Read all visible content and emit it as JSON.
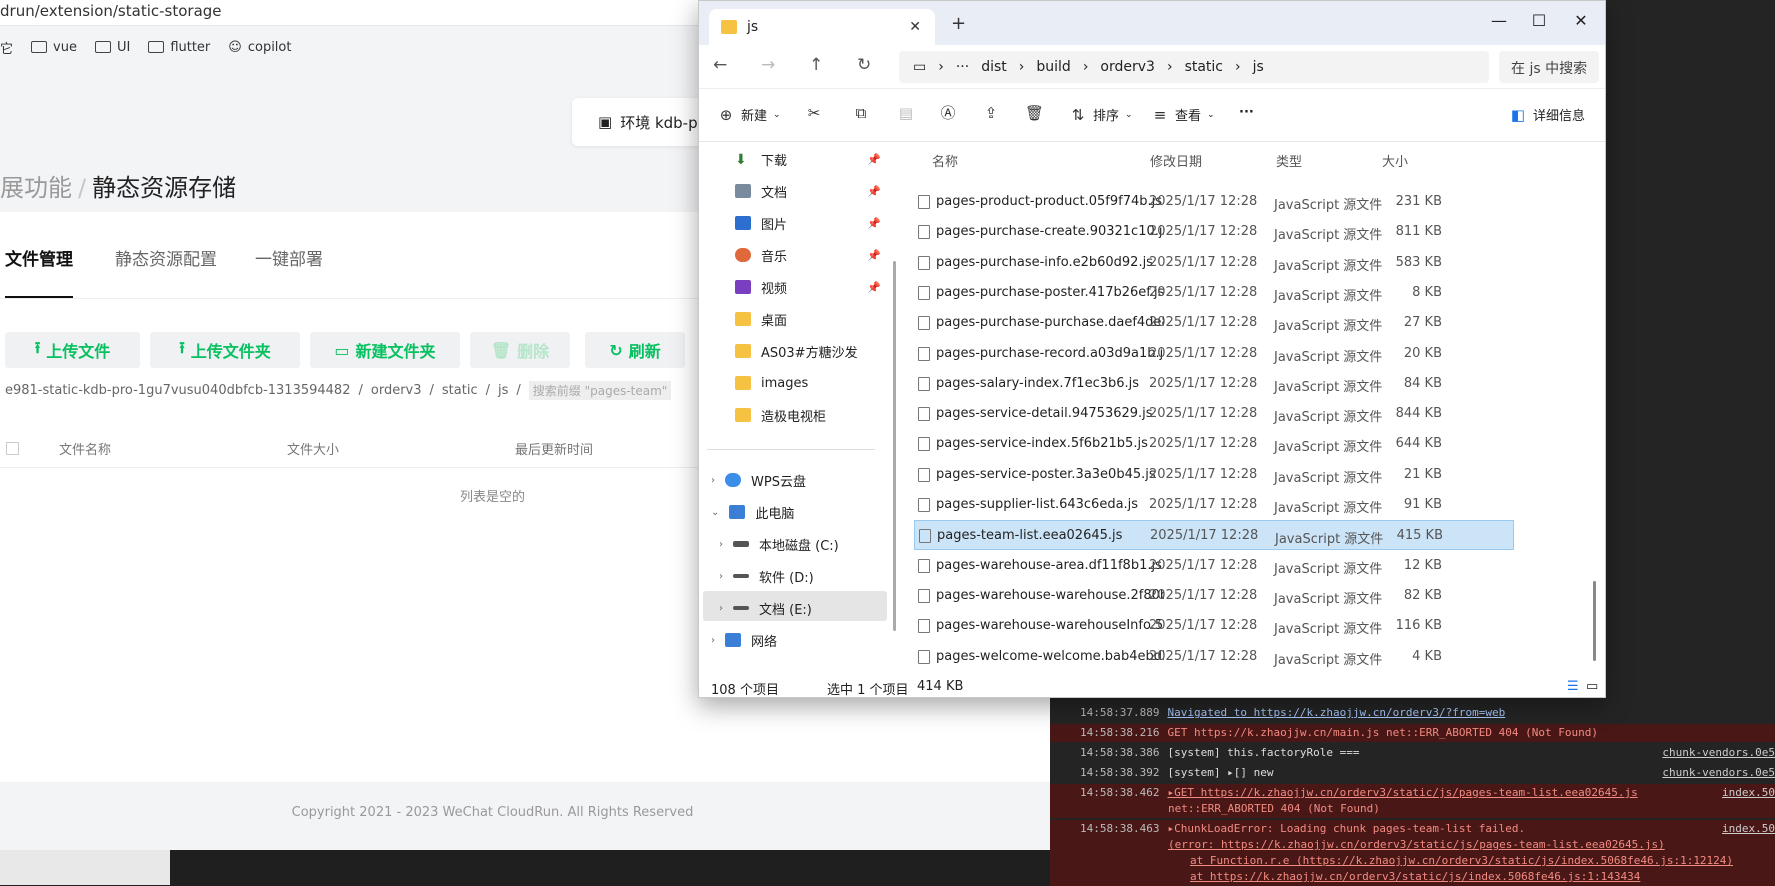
{
  "browser": {
    "url": "drun/extension/static-storage",
    "bookmarks": [
      {
        "label": "它"
      },
      {
        "label": "vue"
      },
      {
        "label": "UI"
      },
      {
        "label": "flutter"
      },
      {
        "label": "copilot"
      }
    ],
    "env_label": "环境 kdb-pro",
    "breadcrumb_parent": "展功能",
    "breadcrumb_sep": "/",
    "page_title": "静态资源存储",
    "tabs": [
      "文件管理",
      "静态资源配置",
      "一键部署"
    ],
    "buttons": [
      "上传文件",
      "上传文件夹",
      "新建文件夹",
      "删除",
      "刷新"
    ],
    "path": [
      "e981-static-kdb-pro-1gu7vusu040dbfcb-1313594482",
      "/",
      "orderv3",
      "/",
      "static",
      "/",
      "js",
      "/"
    ],
    "search_placeholder": "搜索前缀 \"pages-team\"",
    "columns": [
      "文件名称",
      "文件大小",
      "最后更新时间"
    ],
    "empty_text": "列表是空的",
    "copyright": "Copyright 2021 - 2023 WeChat CloudRun. All Rights Reserved"
  },
  "explorer": {
    "tab_title": "js",
    "address": [
      "···",
      "dist",
      "build",
      "orderv3",
      "static",
      "js"
    ],
    "search_placeholder": "在 js 中搜索",
    "commands": {
      "new": "新建",
      "sort": "排序",
      "view": "查看",
      "more": "···",
      "details": "详细信息"
    },
    "nav_items": [
      {
        "label": "下载",
        "pinned": true
      },
      {
        "label": "文档",
        "pinned": true
      },
      {
        "label": "图片",
        "pinned": true
      },
      {
        "label": "音乐",
        "pinned": true
      },
      {
        "label": "视频",
        "pinned": true
      },
      {
        "label": "桌面"
      },
      {
        "label": "AS03#方糖沙发"
      },
      {
        "label": "images"
      },
      {
        "label": "造极电视柜"
      },
      {
        "label": "WPS云盘"
      },
      {
        "label": "此电脑"
      },
      {
        "label": "本地磁盘 (C:)"
      },
      {
        "label": "软件 (D:)"
      },
      {
        "label": "文档 (E:)"
      },
      {
        "label": "网络"
      }
    ],
    "columns": [
      "名称",
      "修改日期",
      "类型",
      "大小"
    ],
    "files": [
      {
        "name": "pages-product-product.05f9f74b.js",
        "date": "2025/1/17 12:28",
        "type": "JavaScript 源文件",
        "size": "231 KB"
      },
      {
        "name": "pages-purchase-create.90321c10.js",
        "date": "2025/1/17 12:28",
        "type": "JavaScript 源文件",
        "size": "811 KB"
      },
      {
        "name": "pages-purchase-info.e2b60d92.js",
        "date": "2025/1/17 12:28",
        "type": "JavaScript 源文件",
        "size": "583 KB"
      },
      {
        "name": "pages-purchase-poster.417b26ef.js",
        "date": "2025/1/17 12:28",
        "type": "JavaScript 源文件",
        "size": "8 KB"
      },
      {
        "name": "pages-purchase-purchase.daef4de8.js",
        "date": "2025/1/17 12:28",
        "type": "JavaScript 源文件",
        "size": "27 KB"
      },
      {
        "name": "pages-purchase-record.a03d9a1b.js",
        "date": "2025/1/17 12:28",
        "type": "JavaScript 源文件",
        "size": "20 KB"
      },
      {
        "name": "pages-salary-index.7f1ec3b6.js",
        "date": "2025/1/17 12:28",
        "type": "JavaScript 源文件",
        "size": "84 KB"
      },
      {
        "name": "pages-service-detail.94753629.js",
        "date": "2025/1/17 12:28",
        "type": "JavaScript 源文件",
        "size": "844 KB"
      },
      {
        "name": "pages-service-index.5f6b21b5.js",
        "date": "2025/1/17 12:28",
        "type": "JavaScript 源文件",
        "size": "644 KB"
      },
      {
        "name": "pages-service-poster.3a3e0b45.js",
        "date": "2025/1/17 12:28",
        "type": "JavaScript 源文件",
        "size": "21 KB"
      },
      {
        "name": "pages-supplier-list.643c6eda.js",
        "date": "2025/1/17 12:28",
        "type": "JavaScript 源文件",
        "size": "91 KB"
      },
      {
        "name": "pages-team-list.eea02645.js",
        "date": "2025/1/17 12:28",
        "type": "JavaScript 源文件",
        "size": "415 KB",
        "selected": true
      },
      {
        "name": "pages-warehouse-area.df11f8b1.js",
        "date": "2025/1/17 12:28",
        "type": "JavaScript 源文件",
        "size": "12 KB"
      },
      {
        "name": "pages-warehouse-warehouse.2f80b2...",
        "date": "2025/1/17 12:28",
        "type": "JavaScript 源文件",
        "size": "82 KB"
      },
      {
        "name": "pages-warehouse-warehouseInfo.53...",
        "date": "2025/1/17 12:28",
        "type": "JavaScript 源文件",
        "size": "116 KB"
      },
      {
        "name": "pages-welcome-welcome.bab4ebd5.js",
        "date": "2025/1/17 12:28",
        "type": "JavaScript 源文件",
        "size": "4 KB"
      }
    ],
    "status_count": "108 个项目",
    "status_selected": "选中 1 个项目",
    "status_size": "414 KB"
  },
  "devtools": {
    "lines": [
      {
        "text": "Navigated to https://k.zhaojjw.cn/orderv3/?from=web",
        "time": "14:58:37.889",
        "source": ""
      },
      {
        "text": "GET https://k.zhaojjw.cn/main.js net::ERR_ABORTED 404 (Not Found)",
        "time": "14:58:38.216",
        "source": "",
        "error": true
      },
      {
        "text": "[system]  this.factoryRole ===",
        "time": "14:58:38.386",
        "source": "chunk-vendors.0e5"
      },
      {
        "text": "[system] ▸[] new",
        "time": "14:58:38.392",
        "source": "chunk-vendors.0e5"
      },
      {
        "text": "▸GET https://k.zhaojjw.cn/orderv3/static/js/pages-team-list.eea02645.js",
        "time": "14:58:38.462",
        "source": "index.50",
        "error": true
      },
      {
        "text": "net::ERR_ABORTED 404 (Not Found)",
        "time": "",
        "source": "",
        "error": true
      },
      {
        "text": "▸ChunkLoadError: Loading chunk pages-team-list failed.",
        "time": "14:58:38.463",
        "source": "index.50",
        "error": true
      },
      {
        "text": "(error: https://k.zhaojjw.cn/orderv3/static/js/pages-team-list.eea02645.js)",
        "time": "",
        "source": "",
        "error": true
      },
      {
        "text": "at Function.r.e (https://k.zhaojjw.cn/orderv3/static/js/index.5068fe46.js:1:12124)",
        "time": "",
        "source": "",
        "error": true
      },
      {
        "text": "at https://k.zhaojjw.cn/orderv3/static/js/index.5068fe46.js:1:143434",
        "time": "",
        "source": "",
        "error": true
      }
    ]
  }
}
